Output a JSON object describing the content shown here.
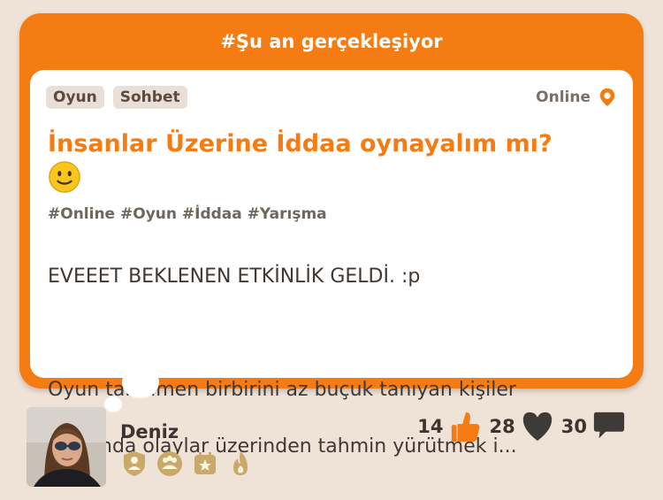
{
  "header": {
    "title": "#Şu an gerçekleşiyor"
  },
  "event": {
    "tags": [
      "Oyun",
      "Sohbet"
    ],
    "status": "Online",
    "title": "İnsanlar Üzerine İddaa oynayalım mı?",
    "emoji": "slightly-smiling-face",
    "hashtags": "#Online #Oyun #İddaa #Yarışma",
    "body_line1": "EVEEET BEKLENEN ETKİNLİK GELDİ. :p",
    "body_line2": "Oyun tamamen birbirini az buçuk tanıyan kişiler",
    "body_line3": "hakkında olaylar üzerinden tahmin yürütmek i..."
  },
  "user": {
    "name": "Deniz",
    "badges": [
      "user-shield-badge",
      "group-badge",
      "star-calendar-badge",
      "flame-badge"
    ]
  },
  "stats": {
    "likes": "14",
    "hearts": "28",
    "comments": "30"
  },
  "colors": {
    "accent": "#f57c12",
    "background": "#efe2d7",
    "tag_bg": "#eadfd6",
    "badge_gold": "#c9a86a"
  }
}
